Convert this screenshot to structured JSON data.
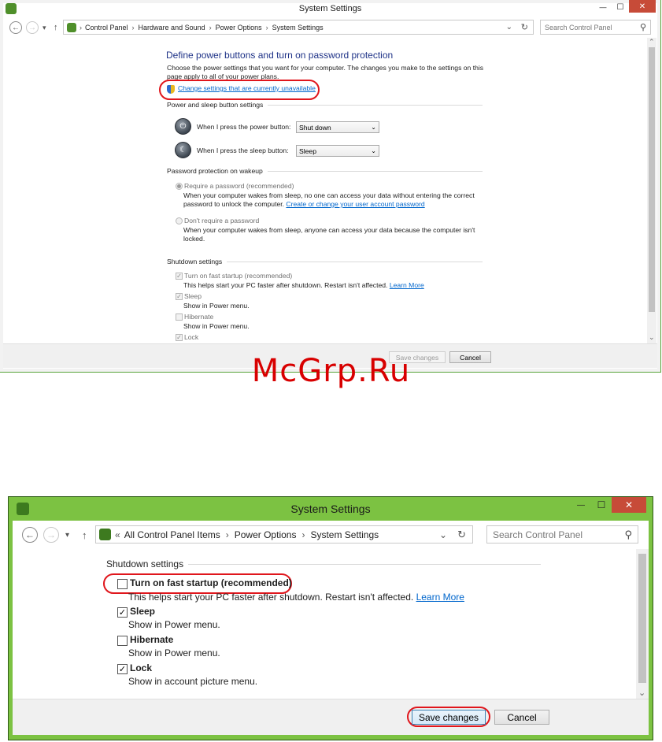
{
  "top_window": {
    "title": "System Settings",
    "breadcrumbs": [
      "Control Panel",
      "Hardware and Sound",
      "Power Options",
      "System Settings"
    ],
    "search_placeholder": "Search Control Panel",
    "heading": "Define power buttons and turn on password protection",
    "intro_line1": "Choose the power settings that you want for your computer. The changes you make to the settings on this",
    "intro_line2": "page apply to all of your power plans.",
    "change_settings_link": "Change settings that are currently unavailable",
    "power_sleep_section": "Power and sleep button settings",
    "power_button_label": "When I press the power button:",
    "power_button_value": "Shut down",
    "sleep_button_label": "When I press the sleep button:",
    "sleep_button_value": "Sleep",
    "password_section": "Password protection on wakeup",
    "require_password_label": "Require a password (recommended)",
    "require_password_desc1": "When your computer wakes from sleep, no one can access your data without entering the correct",
    "require_password_desc2_prefix": "password to unlock the computer.",
    "require_password_link": "Create or change your user account password",
    "no_password_label": "Don't require a password",
    "no_password_desc1": "When your computer wakes from sleep, anyone can access your data because the computer isn't",
    "no_password_desc2": "locked.",
    "shutdown_section": "Shutdown settings",
    "fast_startup_label": "Turn on fast startup (recommended)",
    "fast_startup_desc": "This helps start your PC faster after shutdown. Restart isn't affected.",
    "learn_more": "Learn More",
    "sleep_label": "Sleep",
    "sleep_desc": "Show in Power menu.",
    "hibernate_label": "Hibernate",
    "hibernate_desc": "Show in Power menu.",
    "lock_label": "Lock",
    "save_button": "Save changes",
    "cancel_button": "Cancel"
  },
  "watermark": "McGrp.Ru",
  "bottom_window": {
    "title": "System Settings",
    "breadcrumb_overflow": "«",
    "breadcrumbs": [
      "All Control Panel Items",
      "Power Options",
      "System Settings"
    ],
    "search_placeholder": "Search Control Panel",
    "shutdown_section": "Shutdown settings",
    "fast_startup_label": "Turn on fast startup (recommended)",
    "fast_startup_desc": "This helps start your PC faster after shutdown. Restart isn't affected.",
    "learn_more": "Learn More",
    "sleep_label": "Sleep",
    "sleep_desc": "Show in Power menu.",
    "hibernate_label": "Hibernate",
    "hibernate_desc": "Show in Power menu.",
    "lock_label": "Lock",
    "lock_desc": "Show in account picture menu.",
    "save_button": "Save changes",
    "cancel_button": "Cancel"
  },
  "glyphs": {
    "back": "←",
    "forward": "→",
    "dropdown": "▾",
    "up": "↑",
    "refresh": "↻",
    "search": "⚲",
    "minimize": "—",
    "maximize": "☐",
    "close": "✕",
    "check": "✓",
    "chevron": "⌄",
    "scroll_up": "⌃",
    "scroll_down": "⌄",
    "breadcrumb_sep": "›"
  },
  "colors": {
    "accent_green": "#7cc242",
    "link_blue": "#0066cc",
    "highlight_red": "#e0161c",
    "close_red": "#c74b38"
  }
}
